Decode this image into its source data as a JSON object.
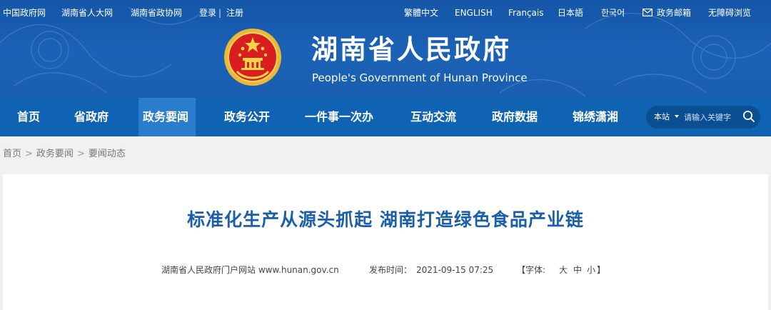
{
  "top_links": {
    "left": [
      "中国政府网",
      "湖南省人大网",
      "湖南省政协网"
    ],
    "login": "登录",
    "divider": "|",
    "register": "注册",
    "right": [
      "繁體中文",
      "ENGLISH",
      "Français",
      "日本語",
      "한국어"
    ],
    "mail": "政务邮箱",
    "accessibility": "无障碍浏览"
  },
  "site": {
    "title_zh": "湖南省人民政府",
    "title_en": "People's Government of Hunan Province"
  },
  "nav": {
    "items": [
      "首页",
      "省政府",
      "政务要闻",
      "政务公开",
      "一件事一次办",
      "互动交流",
      "政府数据",
      "锦绣潇湘"
    ],
    "active_index": 2
  },
  "search": {
    "scope": "本站",
    "placeholder": "请输入关键字"
  },
  "breadcrumb": [
    "首页",
    "政务要闻",
    "要闻动态"
  ],
  "breadcrumb_sep": ">",
  "article": {
    "title": "标准化生产从源头抓起 湖南打造绿色食品产业链",
    "source": "湖南省人民政府门户网站 www.hunan.gov.cn",
    "publish_label": "发布时间：",
    "publish_time": "2021-09-15 07:25",
    "font_open": "【字体:",
    "font_sizes": [
      "大",
      "中",
      "小"
    ],
    "font_close": "】"
  },
  "colors": {
    "header_blue": "#1b62b6",
    "nav_blue": "#0f63b2",
    "nav_active": "#2a7ccc",
    "title_blue": "#1c5fa9"
  },
  "icons": [
    "national-emblem-icon",
    "mail-icon",
    "search-icon",
    "chevron-down-icon"
  ]
}
